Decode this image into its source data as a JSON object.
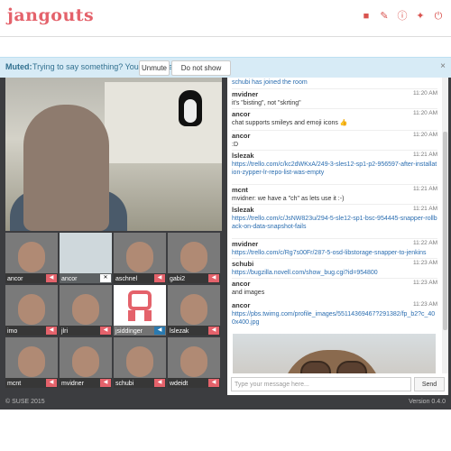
{
  "app": {
    "logo": "jangouts"
  },
  "topbar": {
    "icons": [
      "camera-icon",
      "pen-icon",
      "info-icon",
      "pin-icon",
      "signout-icon"
    ]
  },
  "alert": {
    "label": "Muted:",
    "text": "Trying to say something? You are muted.",
    "unmute": "Unmute",
    "dont_show": "Do not show again",
    "close": "×"
  },
  "participants": [
    {
      "name": "ancor",
      "vol": "speaker"
    },
    {
      "name": "ancor",
      "vol": "close"
    },
    {
      "name": "aschnel",
      "vol": "speaker"
    },
    {
      "name": "gabi2",
      "vol": "speaker"
    },
    {
      "name": "imo",
      "vol": "speaker"
    },
    {
      "name": "jlri",
      "vol": "speaker"
    },
    {
      "name": "jsiddinger",
      "vol": "speaker-blue"
    },
    {
      "name": "lslezak",
      "vol": "speaker"
    },
    {
      "name": "mcnt",
      "vol": "speaker"
    },
    {
      "name": "mvidner",
      "vol": "speaker"
    },
    {
      "name": "schubi",
      "vol": "speaker"
    },
    {
      "name": "wdeidt",
      "vol": "speaker"
    }
  ],
  "chat": {
    "top_line": "schubi has joined the room",
    "messages": [
      {
        "author": "mvidner",
        "time": "11:20 AM",
        "text": "it's \"bisting\", not \"skrting\"",
        "link": ""
      },
      {
        "author": "ancor",
        "time": "11:20 AM",
        "text": "chat supports smileys and emoji icons",
        "link": ""
      },
      {
        "author": "ancor",
        "time": "11:20 AM",
        "text": ":D",
        "link": ""
      },
      {
        "author": "lslezak",
        "time": "11:21 AM",
        "text": "",
        "link": "https://trello.com/c/kc2dWKxA/249-3-sles12-sp1-p2-956597-after-installation-zypper-lr-repo-list-was-empty"
      },
      {
        "author": "mcnt",
        "time": "11:21 AM",
        "text": "mvidner: we have a \"ch\" as lets use it :-)",
        "link": ""
      },
      {
        "author": "lslezak",
        "time": "11:21 AM",
        "text": "",
        "link": "https://trello.com/c/JsNW823u/294-5-sle12-sp1-bsc-954445-snapper-rollback-on-data-snapshot-fails"
      },
      {
        "author": "mvidner",
        "time": "11:22 AM",
        "text": "",
        "link": "https://trello.com/c/Rg7s00Fr/287-5-osd-libstorage-snapper-to-jenkins"
      },
      {
        "author": "schubi",
        "time": "11:23 AM",
        "text": "",
        "link": "https://bugzilla.novell.com/show_bug.cgi?id=954800"
      },
      {
        "author": "ancor",
        "time": "11:23 AM",
        "text": "and images",
        "link": ""
      },
      {
        "author": "ancor",
        "time": "11:23 AM",
        "text": "",
        "link": "https://pbs.twimg.com/profile_images/55114369467?291382/fp_b2?c_400x400.jpg"
      }
    ],
    "input_placeholder": "Type your message here...",
    "send": "Send"
  },
  "footer": {
    "copyright": "© SUSE 2015",
    "version": "Version 0.4.0"
  },
  "colors": {
    "accent": "#e4626b",
    "dark_bg": "#3c3d40",
    "alert_bg": "#d7ebf6",
    "link": "#2a6db0"
  }
}
